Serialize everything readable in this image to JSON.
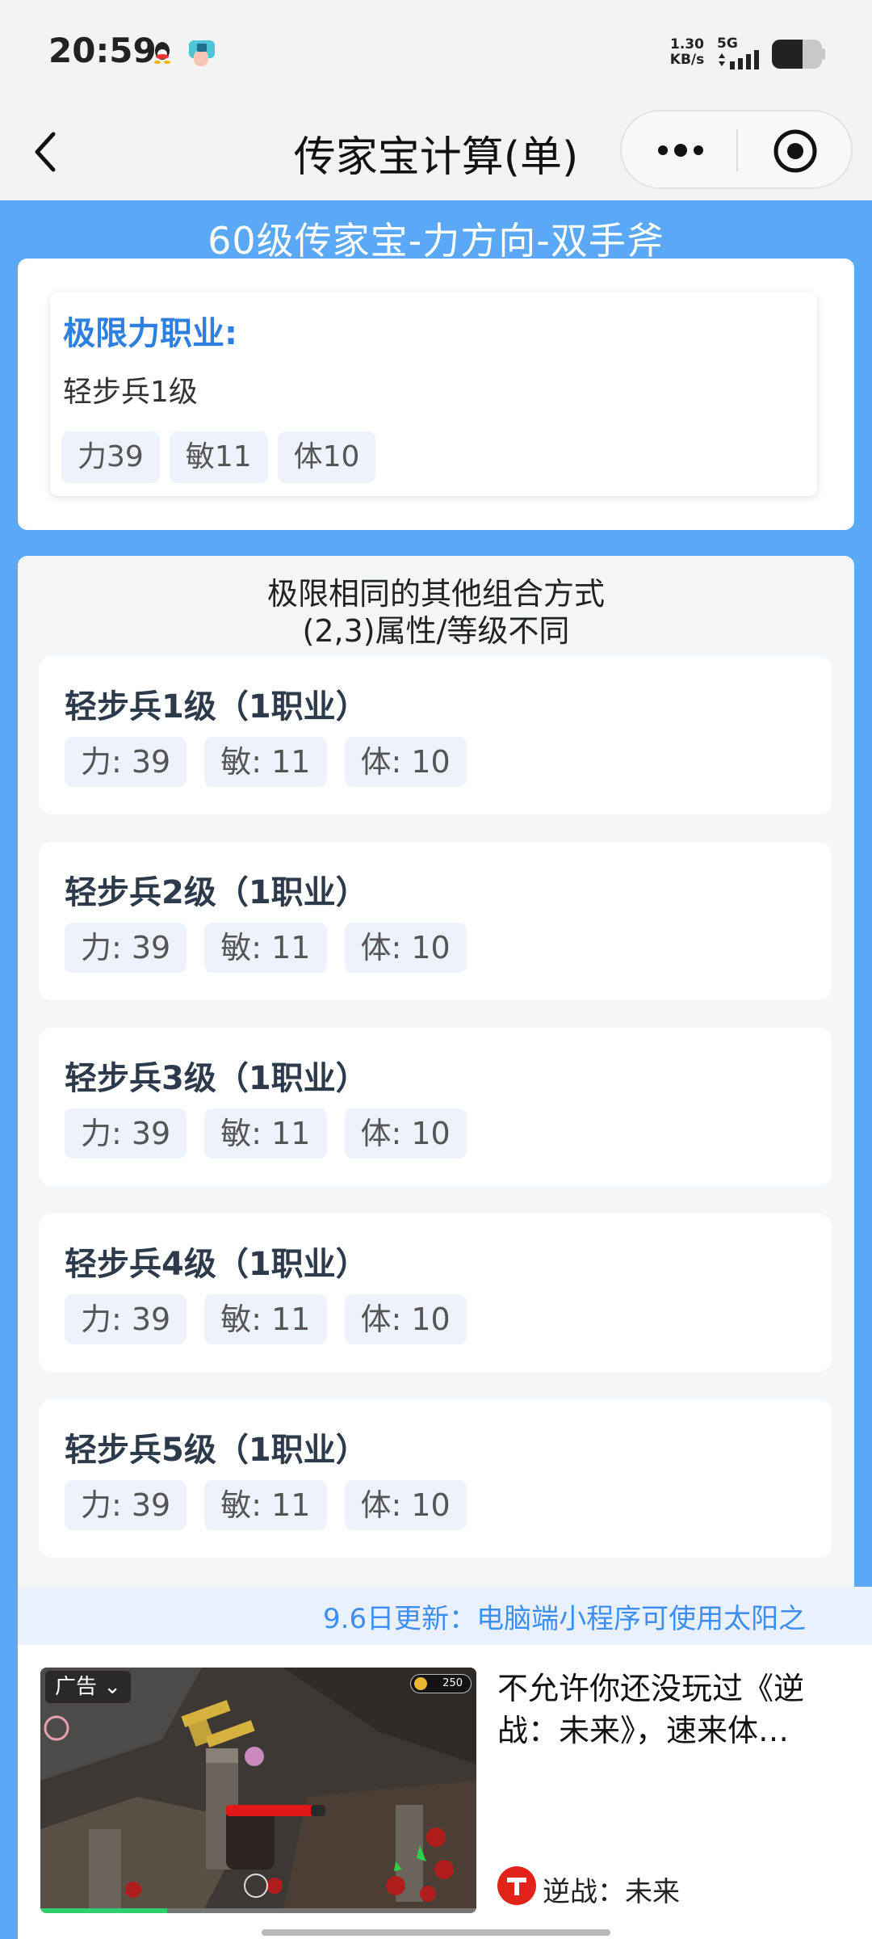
{
  "status_bar": {
    "time": "20:59",
    "net_speed_value": "1.30",
    "net_speed_unit": "KB/s",
    "network": "5G",
    "icons": [
      "qq-icon",
      "app-notification-icon",
      "signal-icon",
      "battery-icon"
    ]
  },
  "nav": {
    "title": "传家宝计算(单)",
    "icons": [
      "back-icon",
      "more-icon",
      "close-mini-program-icon"
    ]
  },
  "banner": {
    "title": "60级传家宝-力方向-双手斧"
  },
  "extreme": {
    "label": "极限力职业:",
    "class_name": "轻步兵1级",
    "stats": [
      "力39",
      "敏11",
      "体10"
    ]
  },
  "combos": {
    "header_line1": "极限相同的其他组合方式",
    "header_line2": "(2,3)属性/等级不同",
    "items": [
      {
        "name": "轻步兵1级（1职业）",
        "str": "力: 39",
        "agi": "敏: 11",
        "vit": "体: 10"
      },
      {
        "name": "轻步兵2级（1职业）",
        "str": "力: 39",
        "agi": "敏: 11",
        "vit": "体: 10"
      },
      {
        "name": "轻步兵3级（1职业）",
        "str": "力: 39",
        "agi": "敏: 11",
        "vit": "体: 10"
      },
      {
        "name": "轻步兵4级（1职业）",
        "str": "力: 39",
        "agi": "敏: 11",
        "vit": "体: 10"
      },
      {
        "name": "轻步兵5级（1职业）",
        "str": "力: 39",
        "agi": "敏: 11",
        "vit": "体: 10"
      }
    ]
  },
  "marquee": {
    "text": "9.6日更新：电脑端小程序可使用太阳之"
  },
  "ad": {
    "tag": "广告",
    "coin_value": "250",
    "title": "不允许你还没玩过《逆战：未来》，速来体…",
    "brand": "逆战：未来",
    "video_progress": 0.29
  },
  "colors": {
    "accent": "#5aa8f6",
    "label_blue": "#2f7fe0",
    "marquee_text": "#3d8ef0",
    "brand_red": "#e2231a"
  }
}
